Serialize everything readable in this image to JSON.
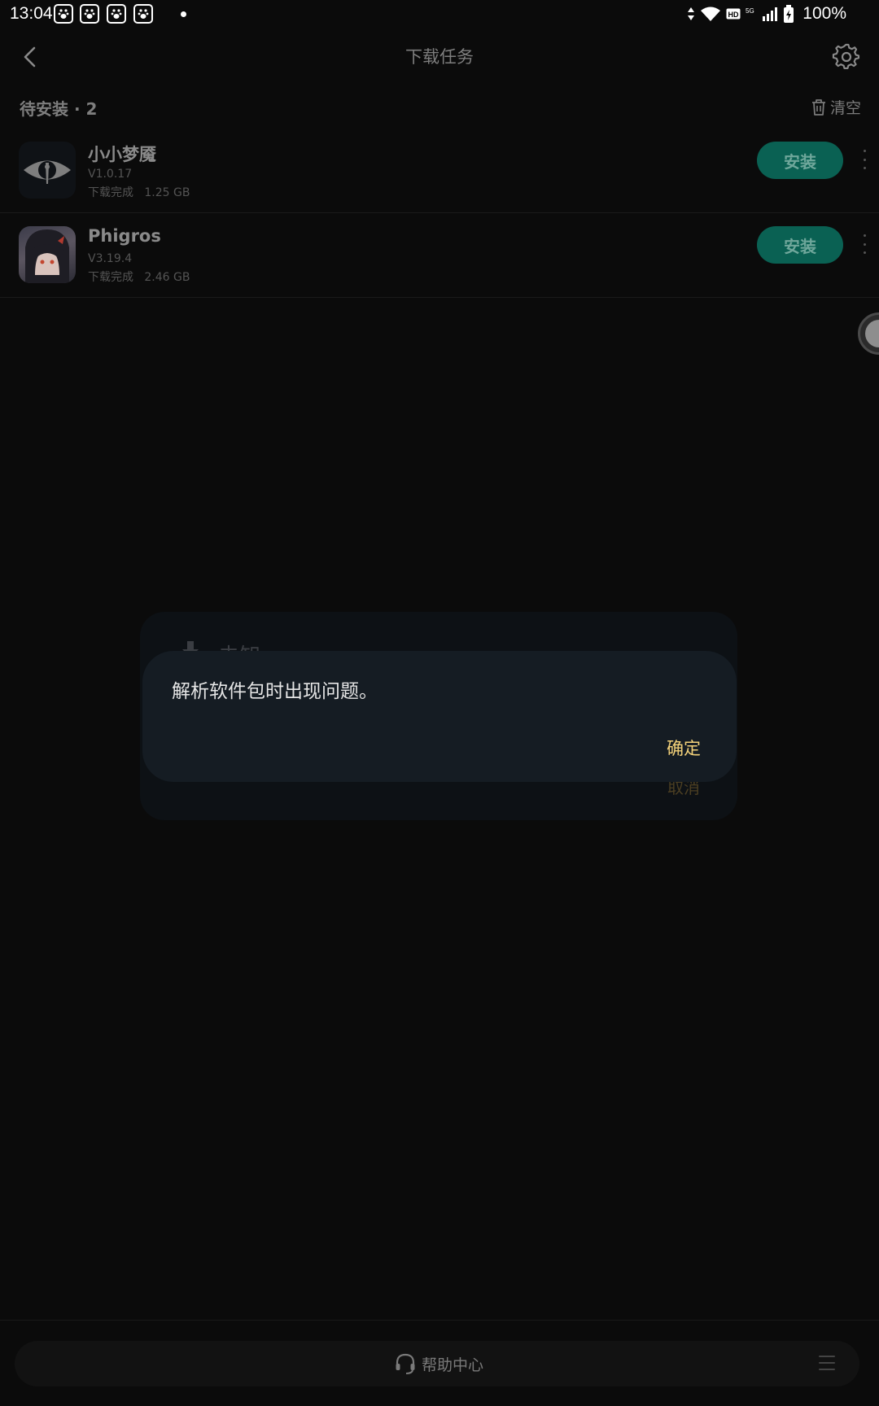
{
  "status_bar": {
    "time": "13:04",
    "notification_icons": [
      "baidu-paw-icon",
      "baidu-paw-icon",
      "baidu-paw-icon",
      "baidu-paw-icon"
    ],
    "network_icons": [
      "data-arrows-icon",
      "wifi-icon",
      "hd-icon",
      "5g-icon",
      "signal-icon"
    ],
    "battery": "100%"
  },
  "header": {
    "title": "下载任务"
  },
  "section": {
    "title": "待安装 · 2",
    "clear_label": "清空"
  },
  "tasks": [
    {
      "name": "小小梦魇",
      "version": "V1.0.17",
      "status": "下载完成   1.25 GB",
      "action_label": "安装"
    },
    {
      "name": "Phigros",
      "version": "V3.19.4",
      "status": "下载完成   2.46 GB",
      "action_label": "安装"
    }
  ],
  "background_dialog": {
    "title": "未知",
    "cancel_label": "取消"
  },
  "alert": {
    "message": "解析软件包时出现问题。",
    "confirm_label": "确定"
  },
  "bottom_bar": {
    "help_label": "帮助中心"
  },
  "colors": {
    "background": "#0b0b0b",
    "install_button": "#0a6153",
    "alert_background": "#151c23",
    "confirm_text": "#f4d27a"
  }
}
